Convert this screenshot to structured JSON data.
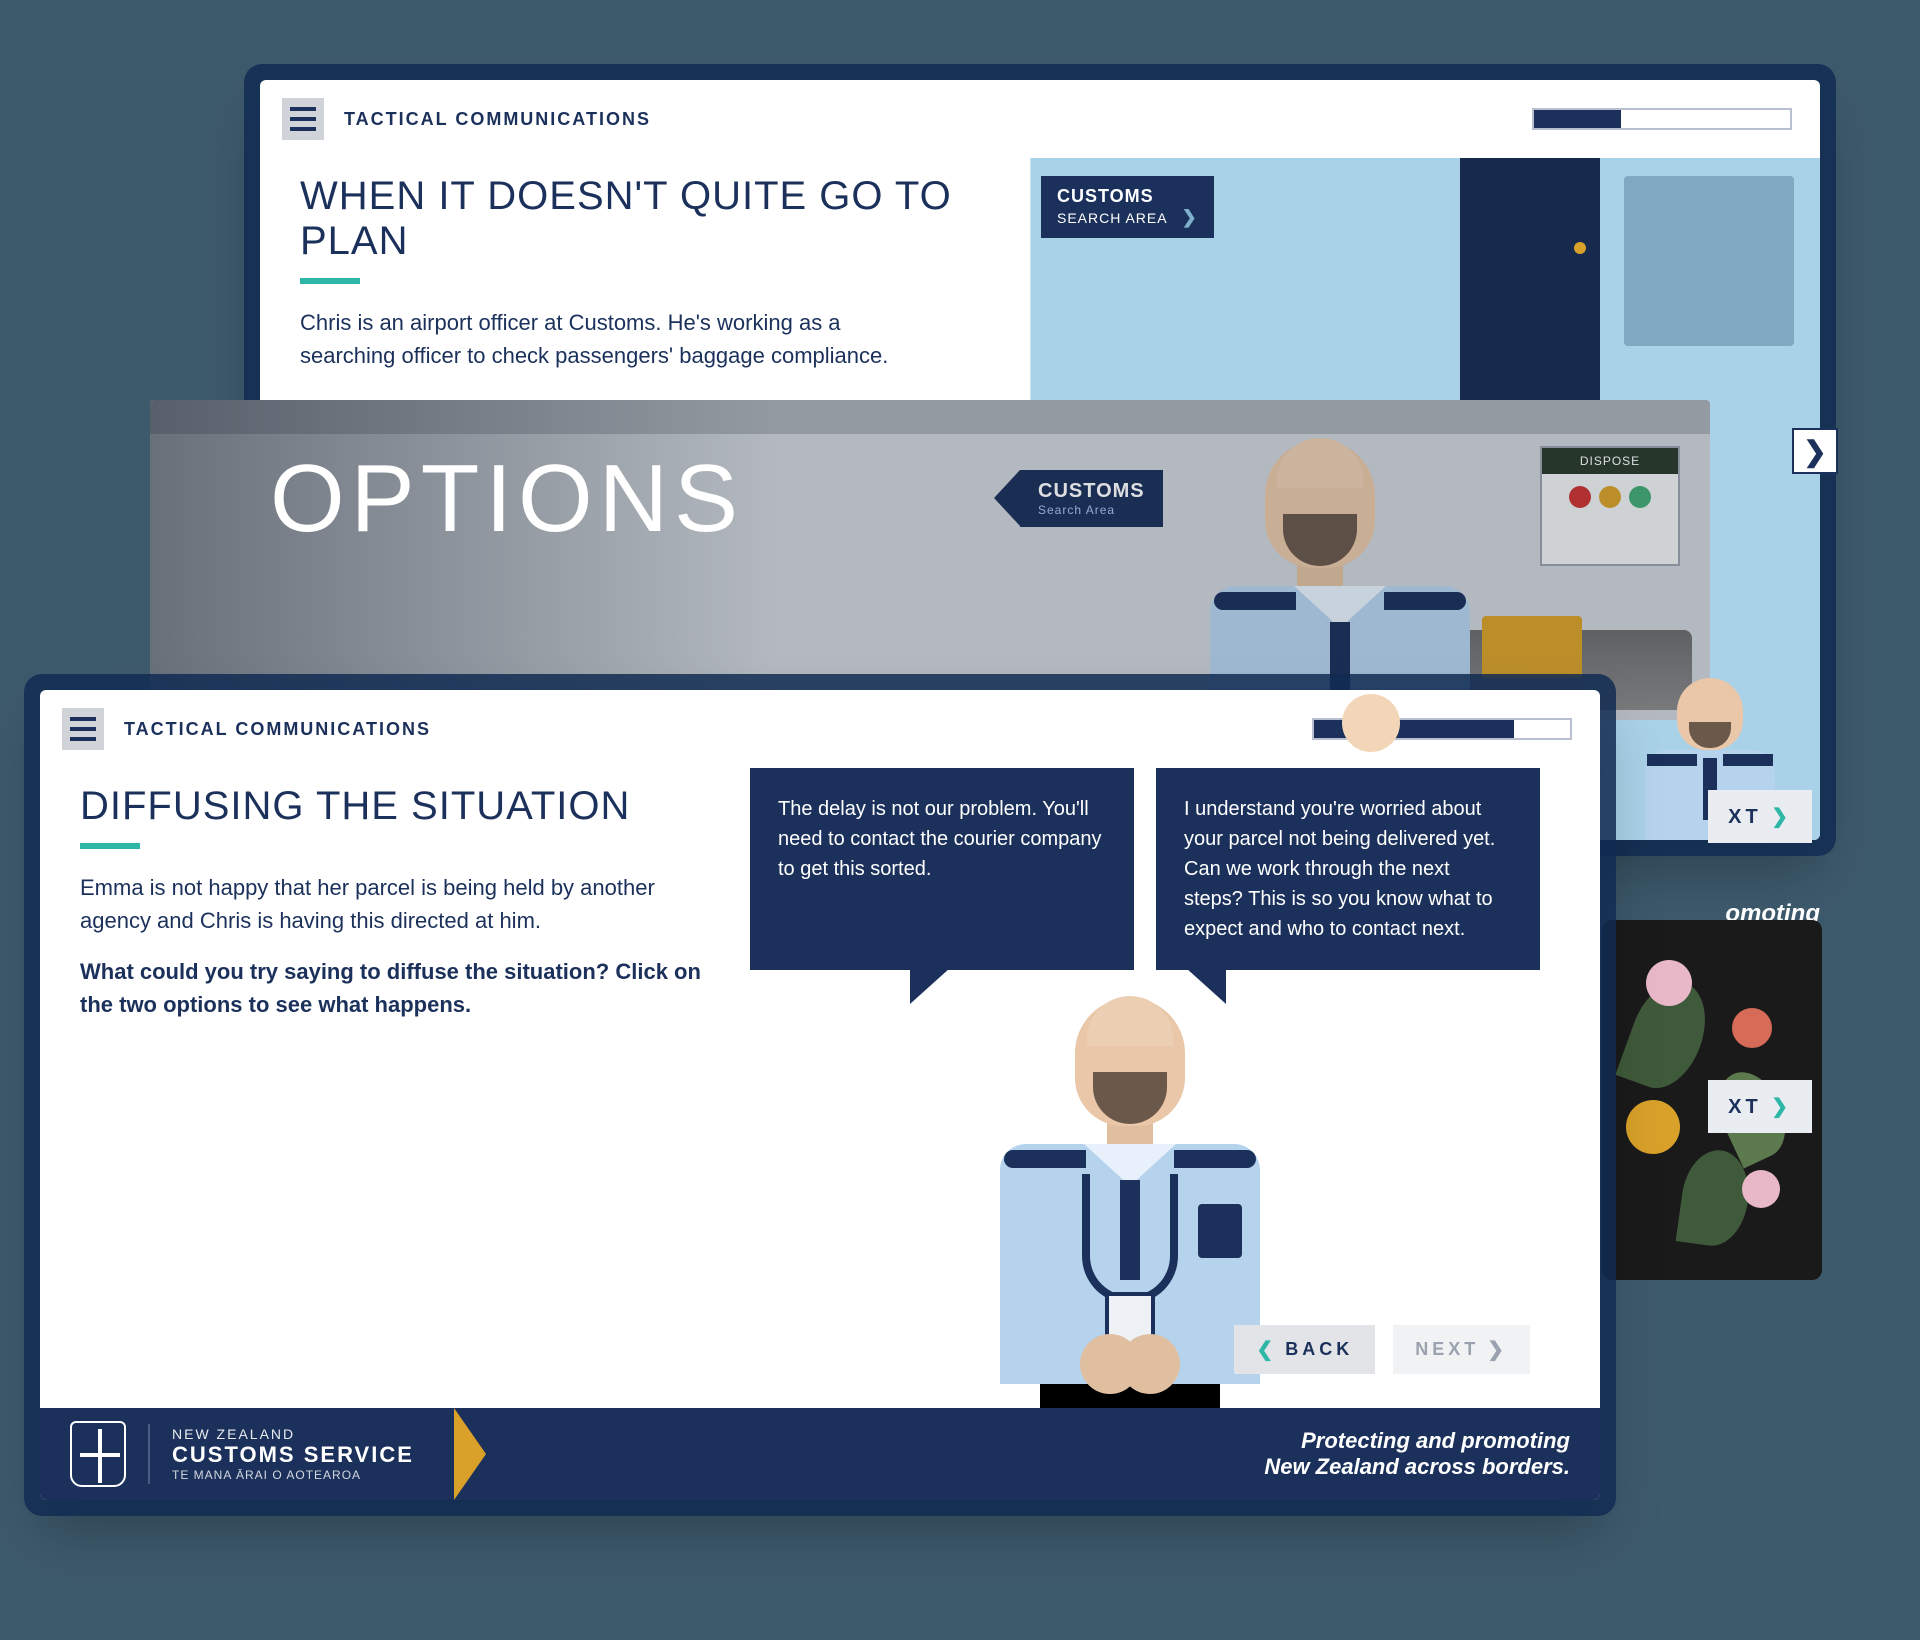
{
  "breadcrumb": "TACTICAL COMMUNICATIONS",
  "brand": {
    "country": "NEW ZEALAND",
    "name": "CUSTOMS SERVICE",
    "maori": "TE MANA ĀRAI O AOTEAROA",
    "tagline_l1": "Protecting and promoting",
    "tagline_l2": "New Zealand across borders."
  },
  "nav": {
    "back": "BACK",
    "next": "NEXT"
  },
  "progress": {
    "back_pct": 34,
    "front_pct": 78
  },
  "banner": {
    "title": "OPTIONS",
    "sign_main": "CUSTOMS",
    "sign_sub": "Search Area",
    "dispose": "DISPOSE"
  },
  "slide_back": {
    "title": "WHEN IT DOESN'T QUITE GO TO PLAN",
    "para": "Chris is an airport officer at Customs. He's working as a searching officer to check passengers' baggage compliance.",
    "sign_line1": "CUSTOMS",
    "sign_line2": "SEARCH AREA"
  },
  "slide_front": {
    "title": "DIFFUSING THE SITUATION",
    "para1": "Emma is not happy that her parcel is being held by another agency and Chris is having this directed at him.",
    "para2": "What could you try saying to diffuse the situation? Click on the two options to see what happens.",
    "option_a": "The delay is not our problem. You'll need to contact the courier company to get this sorted.",
    "option_b": "I understand you're worried about your parcel not being delivered yet. Can we work through the next steps? This is so you know what to expect and who to contact next."
  },
  "peek": {
    "next_fragment": "XT",
    "tag_l1_fragment": "omoting",
    "tag_l2_fragment": "borders."
  }
}
